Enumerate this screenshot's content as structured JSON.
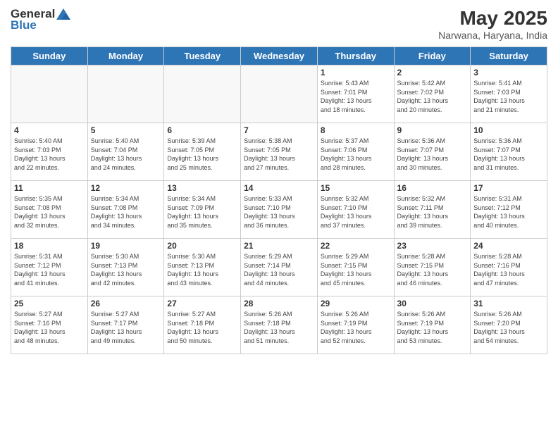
{
  "header": {
    "logo_general": "General",
    "logo_blue": "Blue",
    "month_year": "May 2025",
    "location": "Narwana, Haryana, India"
  },
  "days_of_week": [
    "Sunday",
    "Monday",
    "Tuesday",
    "Wednesday",
    "Thursday",
    "Friday",
    "Saturday"
  ],
  "weeks": [
    {
      "days": [
        {
          "number": "",
          "info": ""
        },
        {
          "number": "",
          "info": ""
        },
        {
          "number": "",
          "info": ""
        },
        {
          "number": "",
          "info": ""
        },
        {
          "number": "1",
          "info": "Sunrise: 5:43 AM\nSunset: 7:01 PM\nDaylight: 13 hours\nand 18 minutes."
        },
        {
          "number": "2",
          "info": "Sunrise: 5:42 AM\nSunset: 7:02 PM\nDaylight: 13 hours\nand 20 minutes."
        },
        {
          "number": "3",
          "info": "Sunrise: 5:41 AM\nSunset: 7:03 PM\nDaylight: 13 hours\nand 21 minutes."
        }
      ]
    },
    {
      "days": [
        {
          "number": "4",
          "info": "Sunrise: 5:40 AM\nSunset: 7:03 PM\nDaylight: 13 hours\nand 22 minutes."
        },
        {
          "number": "5",
          "info": "Sunrise: 5:40 AM\nSunset: 7:04 PM\nDaylight: 13 hours\nand 24 minutes."
        },
        {
          "number": "6",
          "info": "Sunrise: 5:39 AM\nSunset: 7:05 PM\nDaylight: 13 hours\nand 25 minutes."
        },
        {
          "number": "7",
          "info": "Sunrise: 5:38 AM\nSunset: 7:05 PM\nDaylight: 13 hours\nand 27 minutes."
        },
        {
          "number": "8",
          "info": "Sunrise: 5:37 AM\nSunset: 7:06 PM\nDaylight: 13 hours\nand 28 minutes."
        },
        {
          "number": "9",
          "info": "Sunrise: 5:36 AM\nSunset: 7:07 PM\nDaylight: 13 hours\nand 30 minutes."
        },
        {
          "number": "10",
          "info": "Sunrise: 5:36 AM\nSunset: 7:07 PM\nDaylight: 13 hours\nand 31 minutes."
        }
      ]
    },
    {
      "days": [
        {
          "number": "11",
          "info": "Sunrise: 5:35 AM\nSunset: 7:08 PM\nDaylight: 13 hours\nand 32 minutes."
        },
        {
          "number": "12",
          "info": "Sunrise: 5:34 AM\nSunset: 7:08 PM\nDaylight: 13 hours\nand 34 minutes."
        },
        {
          "number": "13",
          "info": "Sunrise: 5:34 AM\nSunset: 7:09 PM\nDaylight: 13 hours\nand 35 minutes."
        },
        {
          "number": "14",
          "info": "Sunrise: 5:33 AM\nSunset: 7:10 PM\nDaylight: 13 hours\nand 36 minutes."
        },
        {
          "number": "15",
          "info": "Sunrise: 5:32 AM\nSunset: 7:10 PM\nDaylight: 13 hours\nand 37 minutes."
        },
        {
          "number": "16",
          "info": "Sunrise: 5:32 AM\nSunset: 7:11 PM\nDaylight: 13 hours\nand 39 minutes."
        },
        {
          "number": "17",
          "info": "Sunrise: 5:31 AM\nSunset: 7:12 PM\nDaylight: 13 hours\nand 40 minutes."
        }
      ]
    },
    {
      "days": [
        {
          "number": "18",
          "info": "Sunrise: 5:31 AM\nSunset: 7:12 PM\nDaylight: 13 hours\nand 41 minutes."
        },
        {
          "number": "19",
          "info": "Sunrise: 5:30 AM\nSunset: 7:13 PM\nDaylight: 13 hours\nand 42 minutes."
        },
        {
          "number": "20",
          "info": "Sunrise: 5:30 AM\nSunset: 7:13 PM\nDaylight: 13 hours\nand 43 minutes."
        },
        {
          "number": "21",
          "info": "Sunrise: 5:29 AM\nSunset: 7:14 PM\nDaylight: 13 hours\nand 44 minutes."
        },
        {
          "number": "22",
          "info": "Sunrise: 5:29 AM\nSunset: 7:15 PM\nDaylight: 13 hours\nand 45 minutes."
        },
        {
          "number": "23",
          "info": "Sunrise: 5:28 AM\nSunset: 7:15 PM\nDaylight: 13 hours\nand 46 minutes."
        },
        {
          "number": "24",
          "info": "Sunrise: 5:28 AM\nSunset: 7:16 PM\nDaylight: 13 hours\nand 47 minutes."
        }
      ]
    },
    {
      "days": [
        {
          "number": "25",
          "info": "Sunrise: 5:27 AM\nSunset: 7:16 PM\nDaylight: 13 hours\nand 48 minutes."
        },
        {
          "number": "26",
          "info": "Sunrise: 5:27 AM\nSunset: 7:17 PM\nDaylight: 13 hours\nand 49 minutes."
        },
        {
          "number": "27",
          "info": "Sunrise: 5:27 AM\nSunset: 7:18 PM\nDaylight: 13 hours\nand 50 minutes."
        },
        {
          "number": "28",
          "info": "Sunrise: 5:26 AM\nSunset: 7:18 PM\nDaylight: 13 hours\nand 51 minutes."
        },
        {
          "number": "29",
          "info": "Sunrise: 5:26 AM\nSunset: 7:19 PM\nDaylight: 13 hours\nand 52 minutes."
        },
        {
          "number": "30",
          "info": "Sunrise: 5:26 AM\nSunset: 7:19 PM\nDaylight: 13 hours\nand 53 minutes."
        },
        {
          "number": "31",
          "info": "Sunrise: 5:26 AM\nSunset: 7:20 PM\nDaylight: 13 hours\nand 54 minutes."
        }
      ]
    }
  ]
}
